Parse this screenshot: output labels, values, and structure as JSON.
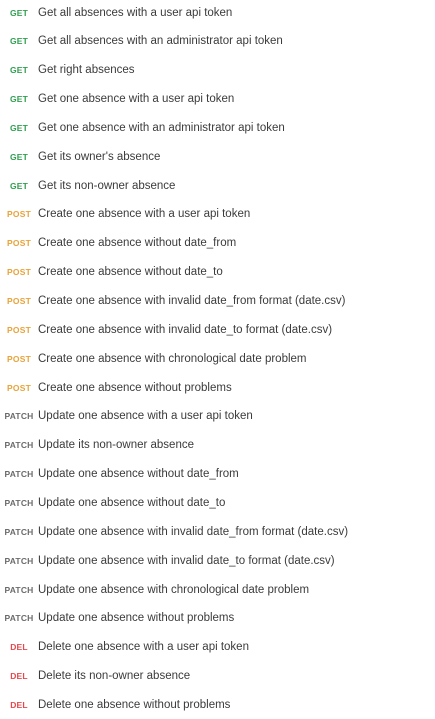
{
  "colors": {
    "GET": "#2f9e4f",
    "POST": "#e8a33a",
    "PATCH": "#6b6b6b",
    "DEL": "#e5484d"
  },
  "requests": [
    {
      "method": "GET",
      "name": "Get all absences with a user api token"
    },
    {
      "method": "GET",
      "name": "Get all absences with an administrator api token"
    },
    {
      "method": "GET",
      "name": "Get right absences"
    },
    {
      "method": "GET",
      "name": "Get one absence with a user api token"
    },
    {
      "method": "GET",
      "name": "Get one absence with an administrator api token"
    },
    {
      "method": "GET",
      "name": "Get its owner's absence"
    },
    {
      "method": "GET",
      "name": "Get its non-owner absence"
    },
    {
      "method": "POST",
      "name": "Create one absence with a user api token"
    },
    {
      "method": "POST",
      "name": "Create one absence without date_from"
    },
    {
      "method": "POST",
      "name": "Create one absence without date_to"
    },
    {
      "method": "POST",
      "name": "Create one absence with invalid date_from format (date.csv)"
    },
    {
      "method": "POST",
      "name": "Create one absence with invalid date_to format (date.csv)"
    },
    {
      "method": "POST",
      "name": "Create one absence with chronological date problem"
    },
    {
      "method": "POST",
      "name": "Create one absence without problems"
    },
    {
      "method": "PATCH",
      "name": "Update one absence with a user api token"
    },
    {
      "method": "PATCH",
      "name": "Update its non-owner absence"
    },
    {
      "method": "PATCH",
      "name": "Update one absence without date_from"
    },
    {
      "method": "PATCH",
      "name": "Update one absence without date_to"
    },
    {
      "method": "PATCH",
      "name": "Update one absence with invalid date_from format (date.csv)"
    },
    {
      "method": "PATCH",
      "name": "Update one absence with invalid date_to format (date.csv)"
    },
    {
      "method": "PATCH",
      "name": "Update one absence with chronological date problem"
    },
    {
      "method": "PATCH",
      "name": "Update one absence without problems"
    },
    {
      "method": "DEL",
      "name": "Delete one absence with a user api token"
    },
    {
      "method": "DEL",
      "name": "Delete its non-owner absence"
    },
    {
      "method": "DEL",
      "name": "Delete one absence without problems"
    }
  ]
}
